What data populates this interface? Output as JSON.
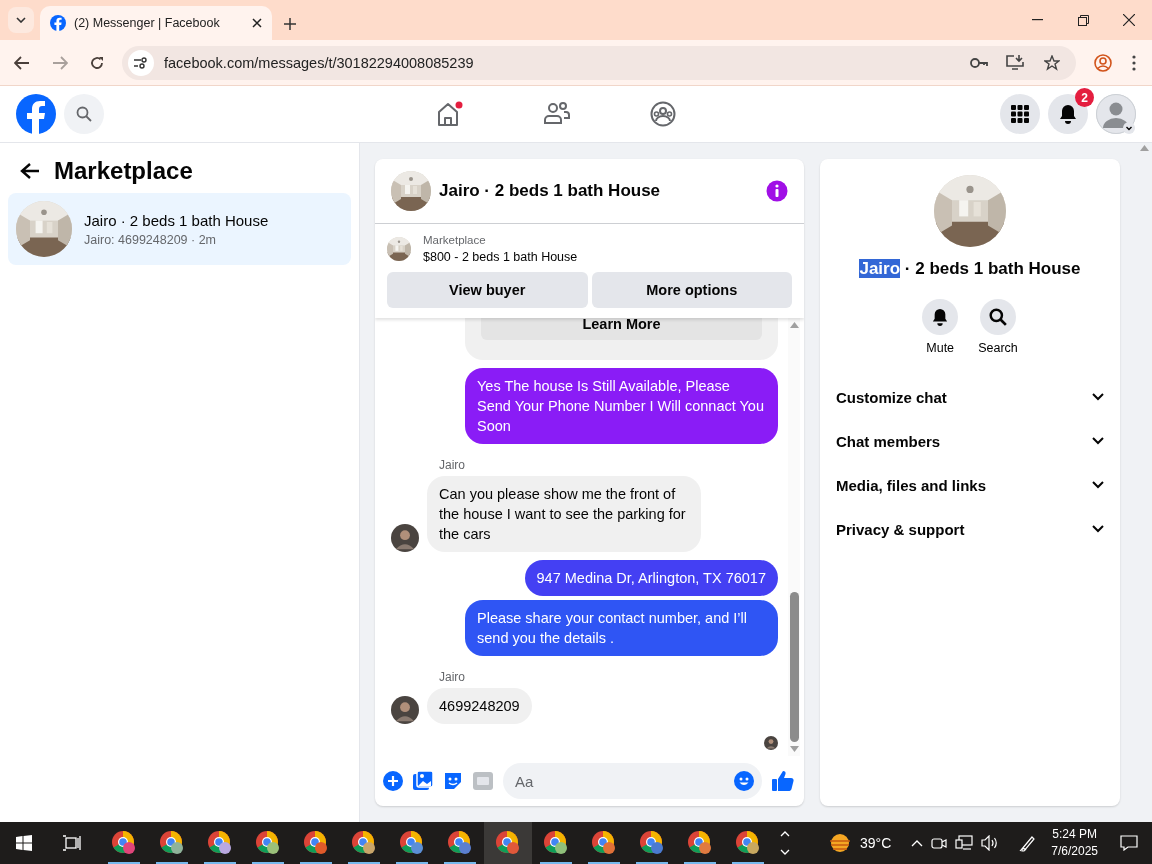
{
  "browser": {
    "tab_title": "(2) Messenger | Facebook",
    "address": "facebook.com/messages/t/30182294008085239"
  },
  "header": {
    "notification_count": "2"
  },
  "sidebar": {
    "title": "Marketplace",
    "conversations": [
      {
        "title": "Jairo · 2 beds 1 bath House",
        "subtitle": "Jairo: 4699248209 · 2m",
        "selected": true
      }
    ]
  },
  "chat": {
    "title": "Jairo · 2 beds 1 bath House",
    "listing": {
      "label": "Marketplace",
      "title": "$800 - 2 beds 1 bath House"
    },
    "listing_buttons": [
      "View buyer",
      "More options"
    ],
    "messages": [
      {
        "kind": "card",
        "button": "Learn More"
      },
      {
        "kind": "outgoing",
        "text": "Yes The house Is Still Available, Please Send Your Phone Number I Will connact You Soon",
        "color": "#8a1cf6"
      },
      {
        "kind": "incoming",
        "sender": "Jairo",
        "text": "Can you please show me the front of the house I want to see the parking for the cars"
      },
      {
        "kind": "outgoing",
        "text": "947 Medina Dr, Arlington, TX 76017",
        "color": "#4440f3"
      },
      {
        "kind": "outgoing",
        "text": "Please share your contact number, and I’ll send you the details .",
        "color": "#2f55f4"
      },
      {
        "kind": "incoming",
        "sender": "Jairo",
        "text": "4699248209"
      }
    ],
    "composer": {
      "placeholder": "Aa"
    }
  },
  "details": {
    "title_highlighted": "Jairo",
    "title_rest": " · 2 beds 1 bath House",
    "actions": [
      {
        "kind": "mute",
        "label": "Mute"
      },
      {
        "kind": "search",
        "label": "Search"
      }
    ],
    "sections": [
      {
        "label": "Customize chat",
        "expanded": false
      },
      {
        "label": "Chat members",
        "expanded": false
      },
      {
        "label": "Media, files and links",
        "expanded": false
      },
      {
        "label": "Privacy & support",
        "expanded": false
      }
    ]
  },
  "taskbar": {
    "apps": [
      {
        "color": "#e0457a",
        "selected": false
      },
      {
        "color": "#8fb39a",
        "selected": false
      },
      {
        "color": "#b9a8e0",
        "selected": false
      },
      {
        "color": "#9bc07a",
        "selected": false
      },
      {
        "color": "#e05a2a",
        "selected": false
      },
      {
        "color": "#c9a56a",
        "selected": false
      },
      {
        "color": "#5b8fd6",
        "selected": false
      },
      {
        "color": "#5b7fd0",
        "selected": false
      },
      {
        "color": "#e0583a",
        "selected": true
      },
      {
        "color": "#8fbf7a",
        "selected": false
      },
      {
        "color": "#e07038",
        "selected": false
      },
      {
        "color": "#4a7ad0",
        "selected": false
      },
      {
        "color": "#e07a40",
        "selected": false
      },
      {
        "color": "#c8a860",
        "selected": false
      }
    ],
    "weather": "39°C",
    "time": "5:24 PM",
    "date": "7/6/2025"
  }
}
